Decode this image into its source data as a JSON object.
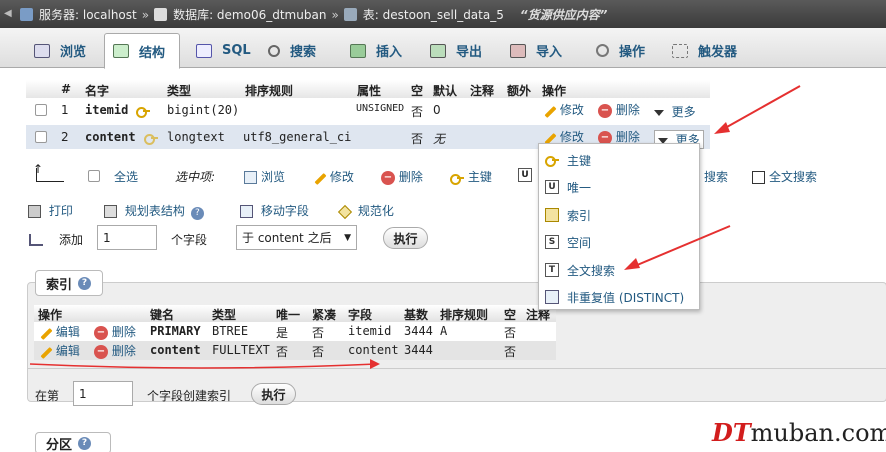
{
  "breadcrumb": {
    "server_label": "服务器: localhost",
    "database_label": "数据库: demo06_dtmuban",
    "table_label": "表: destoon_sell_data_5",
    "table_comment": "“货源供应内容”",
    "separator": "»"
  },
  "tabs": [
    {
      "label": "浏览"
    },
    {
      "label": "结构"
    },
    {
      "label": "SQL"
    },
    {
      "label": "搜索"
    },
    {
      "label": "插入"
    },
    {
      "label": "导出"
    },
    {
      "label": "导入"
    },
    {
      "label": "操作"
    },
    {
      "label": "触发器"
    }
  ],
  "structure": {
    "headers": [
      "#",
      "名字",
      "类型",
      "排序规则",
      "属性",
      "空",
      "默认",
      "注释",
      "额外",
      "操作"
    ],
    "rows": [
      {
        "num": "1",
        "name": "itemid",
        "type": "bigint(20)",
        "collation": "",
        "attributes": "UNSIGNED",
        "null": "否",
        "default": "0",
        "edit": "修改",
        "delete": "删除",
        "more": "更多"
      },
      {
        "num": "2",
        "name": "content",
        "type": "longtext",
        "collation": "utf8_general_ci",
        "attributes": "",
        "null": "否",
        "default": "无",
        "edit": "修改",
        "delete": "删除",
        "more": "更多"
      }
    ]
  },
  "checkall": {
    "select_all": "全选",
    "with_selected": "选中项:",
    "browse": "浏览",
    "change": "修改",
    "drop": "删除",
    "primary": "主键",
    "unique_hidden": "U",
    "search": "搜索",
    "fulltext": "全文搜索"
  },
  "dropdown": {
    "items": [
      "主键",
      "唯一",
      "索引",
      "空间",
      "全文搜索",
      "非重复值 (DISTINCT)"
    ]
  },
  "actions": {
    "print": "打印",
    "propose": "规划表结构",
    "move": "移动字段",
    "normalize": "规范化"
  },
  "add_field": {
    "label": "添加",
    "count": "1",
    "unit": "个字段",
    "position": "于 content 之后",
    "go": "执行"
  },
  "indexes": {
    "legend": "索引",
    "headers": [
      "操作",
      "键名",
      "类型",
      "唯一",
      "紧凑",
      "字段",
      "基数",
      "排序规则",
      "空",
      "注释"
    ],
    "rows": [
      {
        "edit": "编辑",
        "delete": "删除",
        "key": "PRIMARY",
        "type": "BTREE",
        "unique": "是",
        "packed": "否",
        "column": "itemid",
        "cardinality": "3444",
        "collation": "A",
        "null": "否"
      },
      {
        "edit": "编辑",
        "delete": "删除",
        "key": "content",
        "type": "FULLTEXT",
        "unique": "否",
        "packed": "否",
        "column": "content",
        "cardinality": "3444",
        "collation": "",
        "null": "否"
      }
    ],
    "create_prefix": "在第",
    "create_count": "1",
    "create_suffix": "个字段创建索引",
    "go": "执行"
  },
  "partition": {
    "legend": "分区"
  },
  "watermark": {
    "brand": "DT",
    "domain": "muban.com"
  },
  "colors": {
    "link": "#235a81",
    "annotation": "#e53030",
    "topbar": "#4a4a4a"
  }
}
